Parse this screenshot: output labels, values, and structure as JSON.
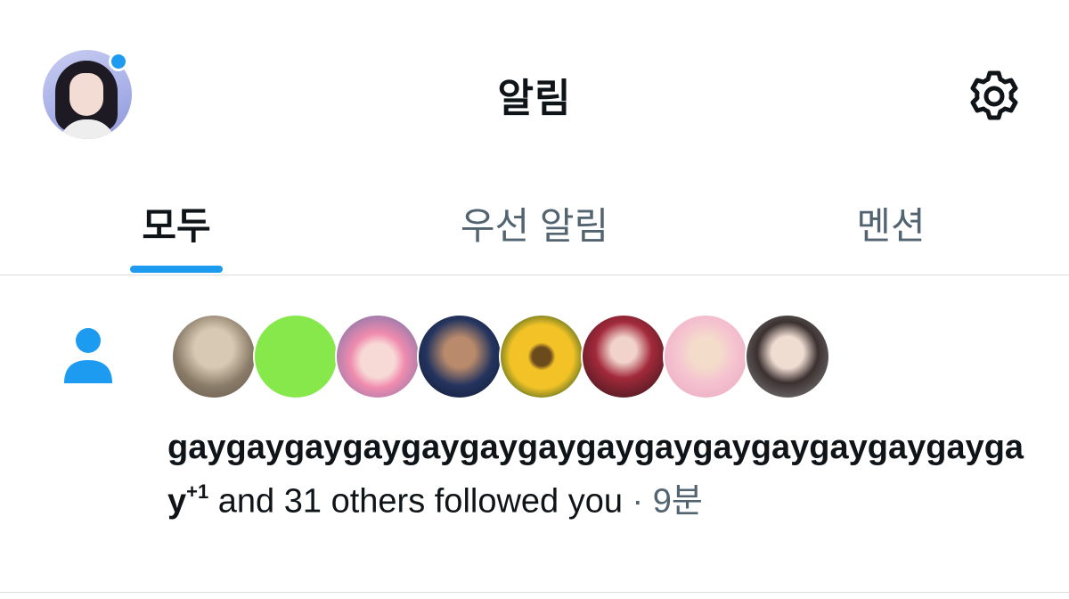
{
  "header": {
    "title": "알림",
    "avatar_icon": "user-avatar",
    "settings_icon": "gear-icon",
    "accent_color": "#1d9bf0"
  },
  "tabs": [
    {
      "label": "모두",
      "active": true
    },
    {
      "label": "우선 알림",
      "active": false
    },
    {
      "label": "멘션",
      "active": false
    }
  ],
  "notification": {
    "icon": "person-icon",
    "avatar_count": 8,
    "username": "gaygaygaygaygaygaygaygaygaygaygaygaygaygaygay",
    "superscript": "+1",
    "text": " and 31 others followed you",
    "separator": " · ",
    "time": "9분"
  }
}
